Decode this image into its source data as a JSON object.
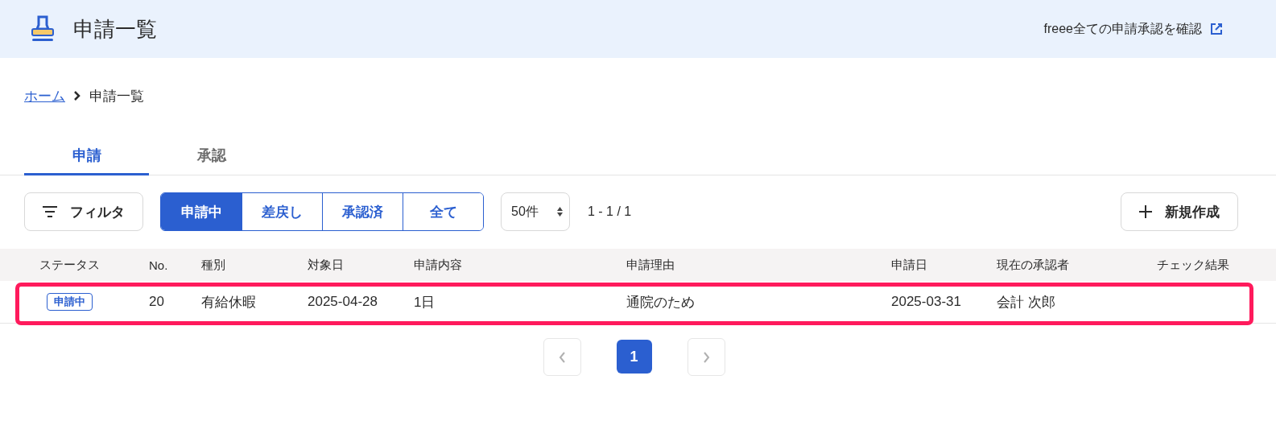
{
  "header": {
    "title": "申請一覧",
    "link": "freee全ての申請承認を確認"
  },
  "breadcrumb": [
    {
      "label": "ホーム",
      "link": true
    },
    {
      "label": "申請一覧",
      "link": false
    }
  ],
  "tabs": [
    {
      "label": "申請",
      "selected": true
    },
    {
      "label": "承認",
      "selected": false
    }
  ],
  "toolbar": {
    "filter_button": "フィルタ",
    "status_filters": [
      {
        "label": "申請中",
        "selected": true
      },
      {
        "label": "差戻し",
        "selected": false
      },
      {
        "label": "承認済",
        "selected": false
      },
      {
        "label": "全て",
        "selected": false
      }
    ],
    "page_size": "50件",
    "range": "1 - 1 / 1",
    "new_button": "新規作成"
  },
  "table": {
    "columns": [
      "ステータス",
      "No.",
      "種別",
      "対象日",
      "申請内容",
      "申請理由",
      "申請日",
      "現在の承認者",
      "チェック結果"
    ],
    "rows": [
      {
        "cells": [
          "申請中",
          "20",
          "有給休暇",
          "2025-04-28",
          "1日",
          "通院のため",
          "2025-03-31",
          "会計 次郎"
        ],
        "highlighted": true
      }
    ]
  },
  "pagination": {
    "prev": {
      "disabled": true
    },
    "next": {
      "disabled": true
    },
    "pages": [
      {
        "label": "1",
        "selected": true
      }
    ]
  }
}
